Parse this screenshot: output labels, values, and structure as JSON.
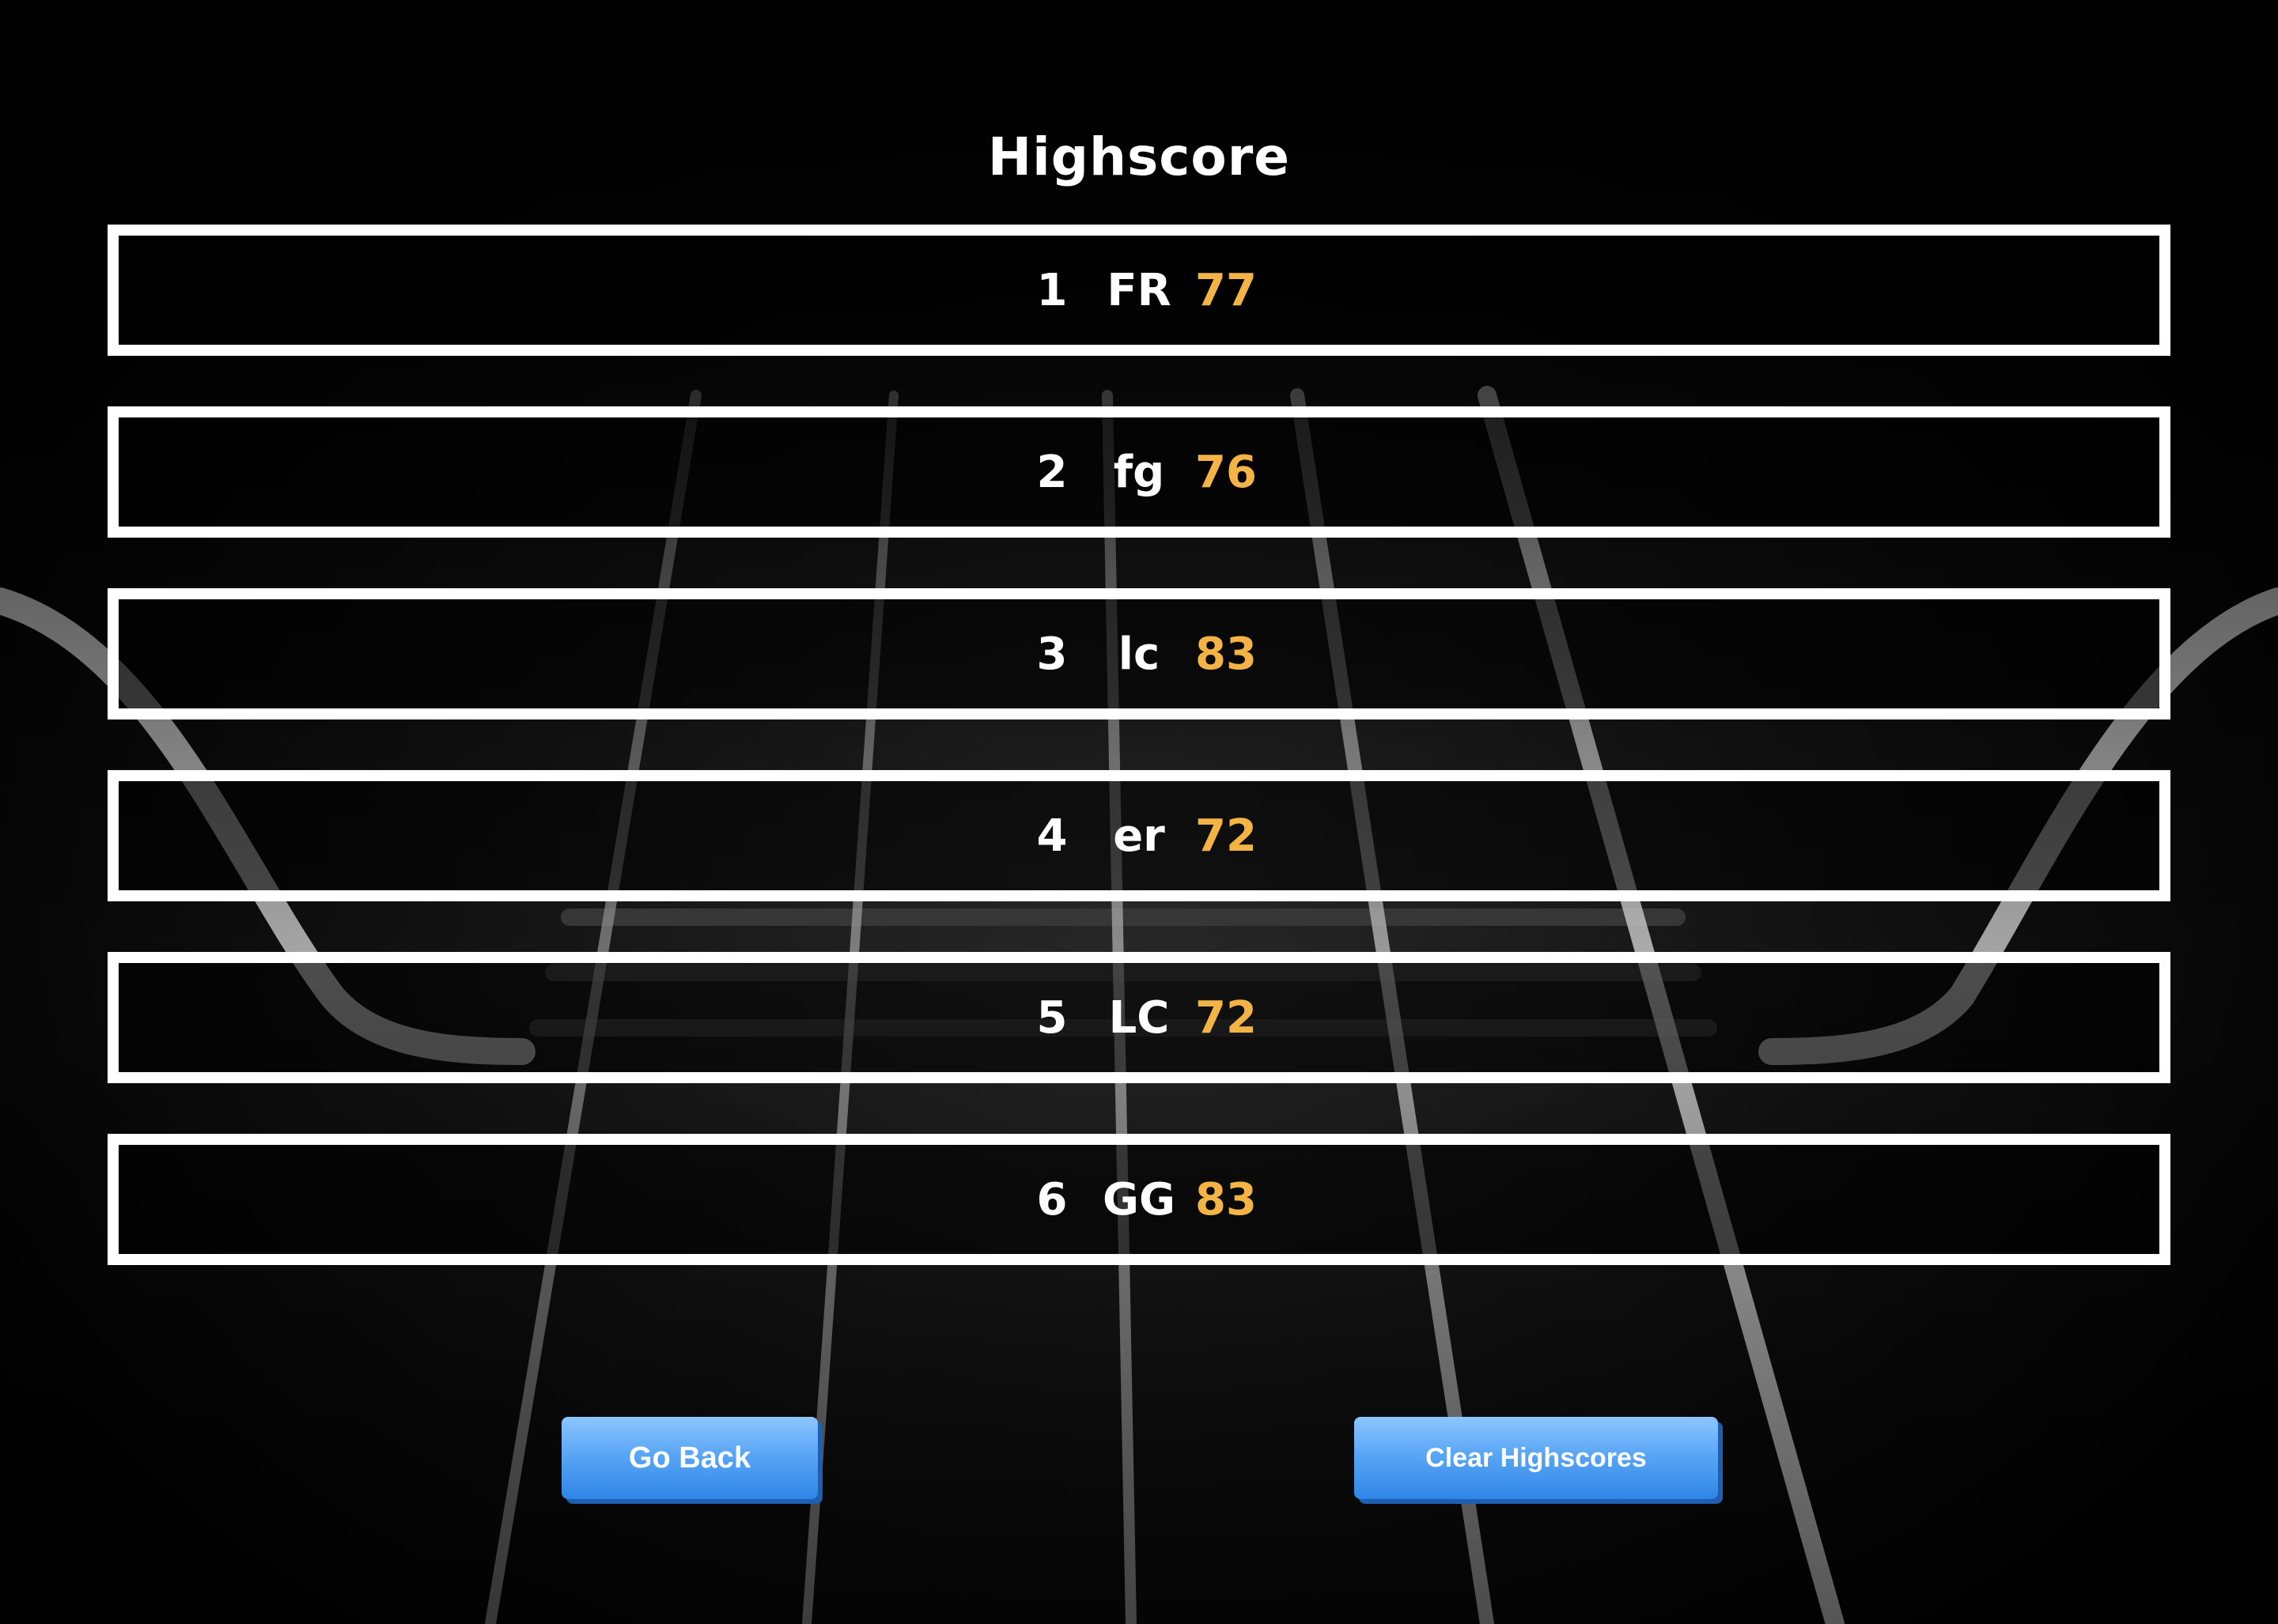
{
  "page": {
    "title": "Highscore"
  },
  "colors": {
    "background": "#000000",
    "text": "#ffffff",
    "score": "#f3b445",
    "button": "#4a9cf0"
  },
  "scores": [
    {
      "rank": "1",
      "name": "FR",
      "score": "77"
    },
    {
      "rank": "2",
      "name": "fg",
      "score": "76"
    },
    {
      "rank": "3",
      "name": "lc",
      "score": "83"
    },
    {
      "rank": "4",
      "name": "er",
      "score": "72"
    },
    {
      "rank": "5",
      "name": "LC",
      "score": "72"
    },
    {
      "rank": "6",
      "name": "GG",
      "score": "83"
    }
  ],
  "buttons": {
    "back_label": "Go Back",
    "clear_label": "Clear Highscores"
  }
}
